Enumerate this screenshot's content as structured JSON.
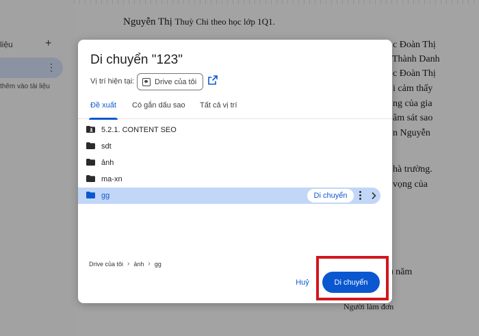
{
  "background": {
    "outline": {
      "title_fragment": "liệu",
      "add_symbol": "+",
      "menu_symbol": "⋮",
      "hint_fragment": "thêm vào tài liệu"
    },
    "document": {
      "heading_main": "Nguyễn Thị",
      "heading_rest": "Thuỳ Chi theo học lớp 1Q1.",
      "lines": [
        "c Đoàn Thị",
        "Thành Danh",
        "c Đoàn Thị",
        "i cảm thấy",
        "ng của gia",
        "âm sát sao",
        "n Nguyễn",
        "hà trường.",
        "vọng của",
        ") năm",
        "Người làm đơn"
      ]
    }
  },
  "dialog": {
    "title": "Di chuyển \"123\"",
    "location_label": "Vị trí hiện tại:",
    "location_value": "Drive của tôi",
    "tabs": [
      {
        "label": "Đề xuất",
        "active": true
      },
      {
        "label": "Có gắn dấu sao",
        "active": false
      },
      {
        "label": "Tất cả vị trí",
        "active": false
      }
    ],
    "folders": [
      {
        "name": "5.2.1. CONTENT SEO",
        "icon": "shared-folder-icon",
        "selected": false
      },
      {
        "name": "sdt",
        "icon": "folder-icon",
        "selected": false
      },
      {
        "name": "ảnh",
        "icon": "folder-icon",
        "selected": false
      },
      {
        "name": "ma-xn",
        "icon": "folder-icon",
        "selected": false
      },
      {
        "name": "gg",
        "icon": "folder-icon",
        "selected": true
      }
    ],
    "row_move_label": "Di chuyển",
    "breadcrumb": [
      "Drive của tôi",
      "ảnh",
      "gg"
    ],
    "cancel_label": "Huỷ",
    "move_label": "Di chuyển"
  },
  "colors": {
    "accent": "#0b57d0",
    "selected_row": "#c2d7f7",
    "highlight": "#d1161e"
  }
}
